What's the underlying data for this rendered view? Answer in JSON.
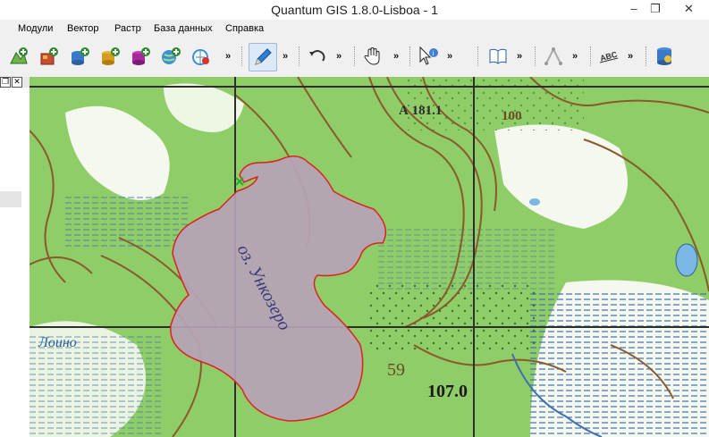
{
  "window": {
    "title": "Quantum GIS 1.8.0-Lisboa - 1",
    "minimize_glyph": "–",
    "restore_glyph": "❐",
    "close_glyph": "✕"
  },
  "menu": {
    "items": [
      "Модули",
      "Вектор",
      "Растр",
      "База данных",
      "Справка"
    ]
  },
  "toolbar": {
    "overflow_glyph": "»"
  },
  "map": {
    "lake_label": "оз. Ункозеро",
    "marker_a": "А 181.1",
    "marker_b": "100",
    "marker_c": "59",
    "marker_d": "107.0",
    "river_label": "Лоино",
    "lake_fill": "#b7a3b7",
    "lake_outline": "#e02020",
    "grid_color": "#2e2e2e",
    "forest_color": "#9fd27a",
    "contour_color": "#8a5a2b"
  },
  "panel": {
    "close_glyph": "✕",
    "float_glyph": "❐"
  }
}
